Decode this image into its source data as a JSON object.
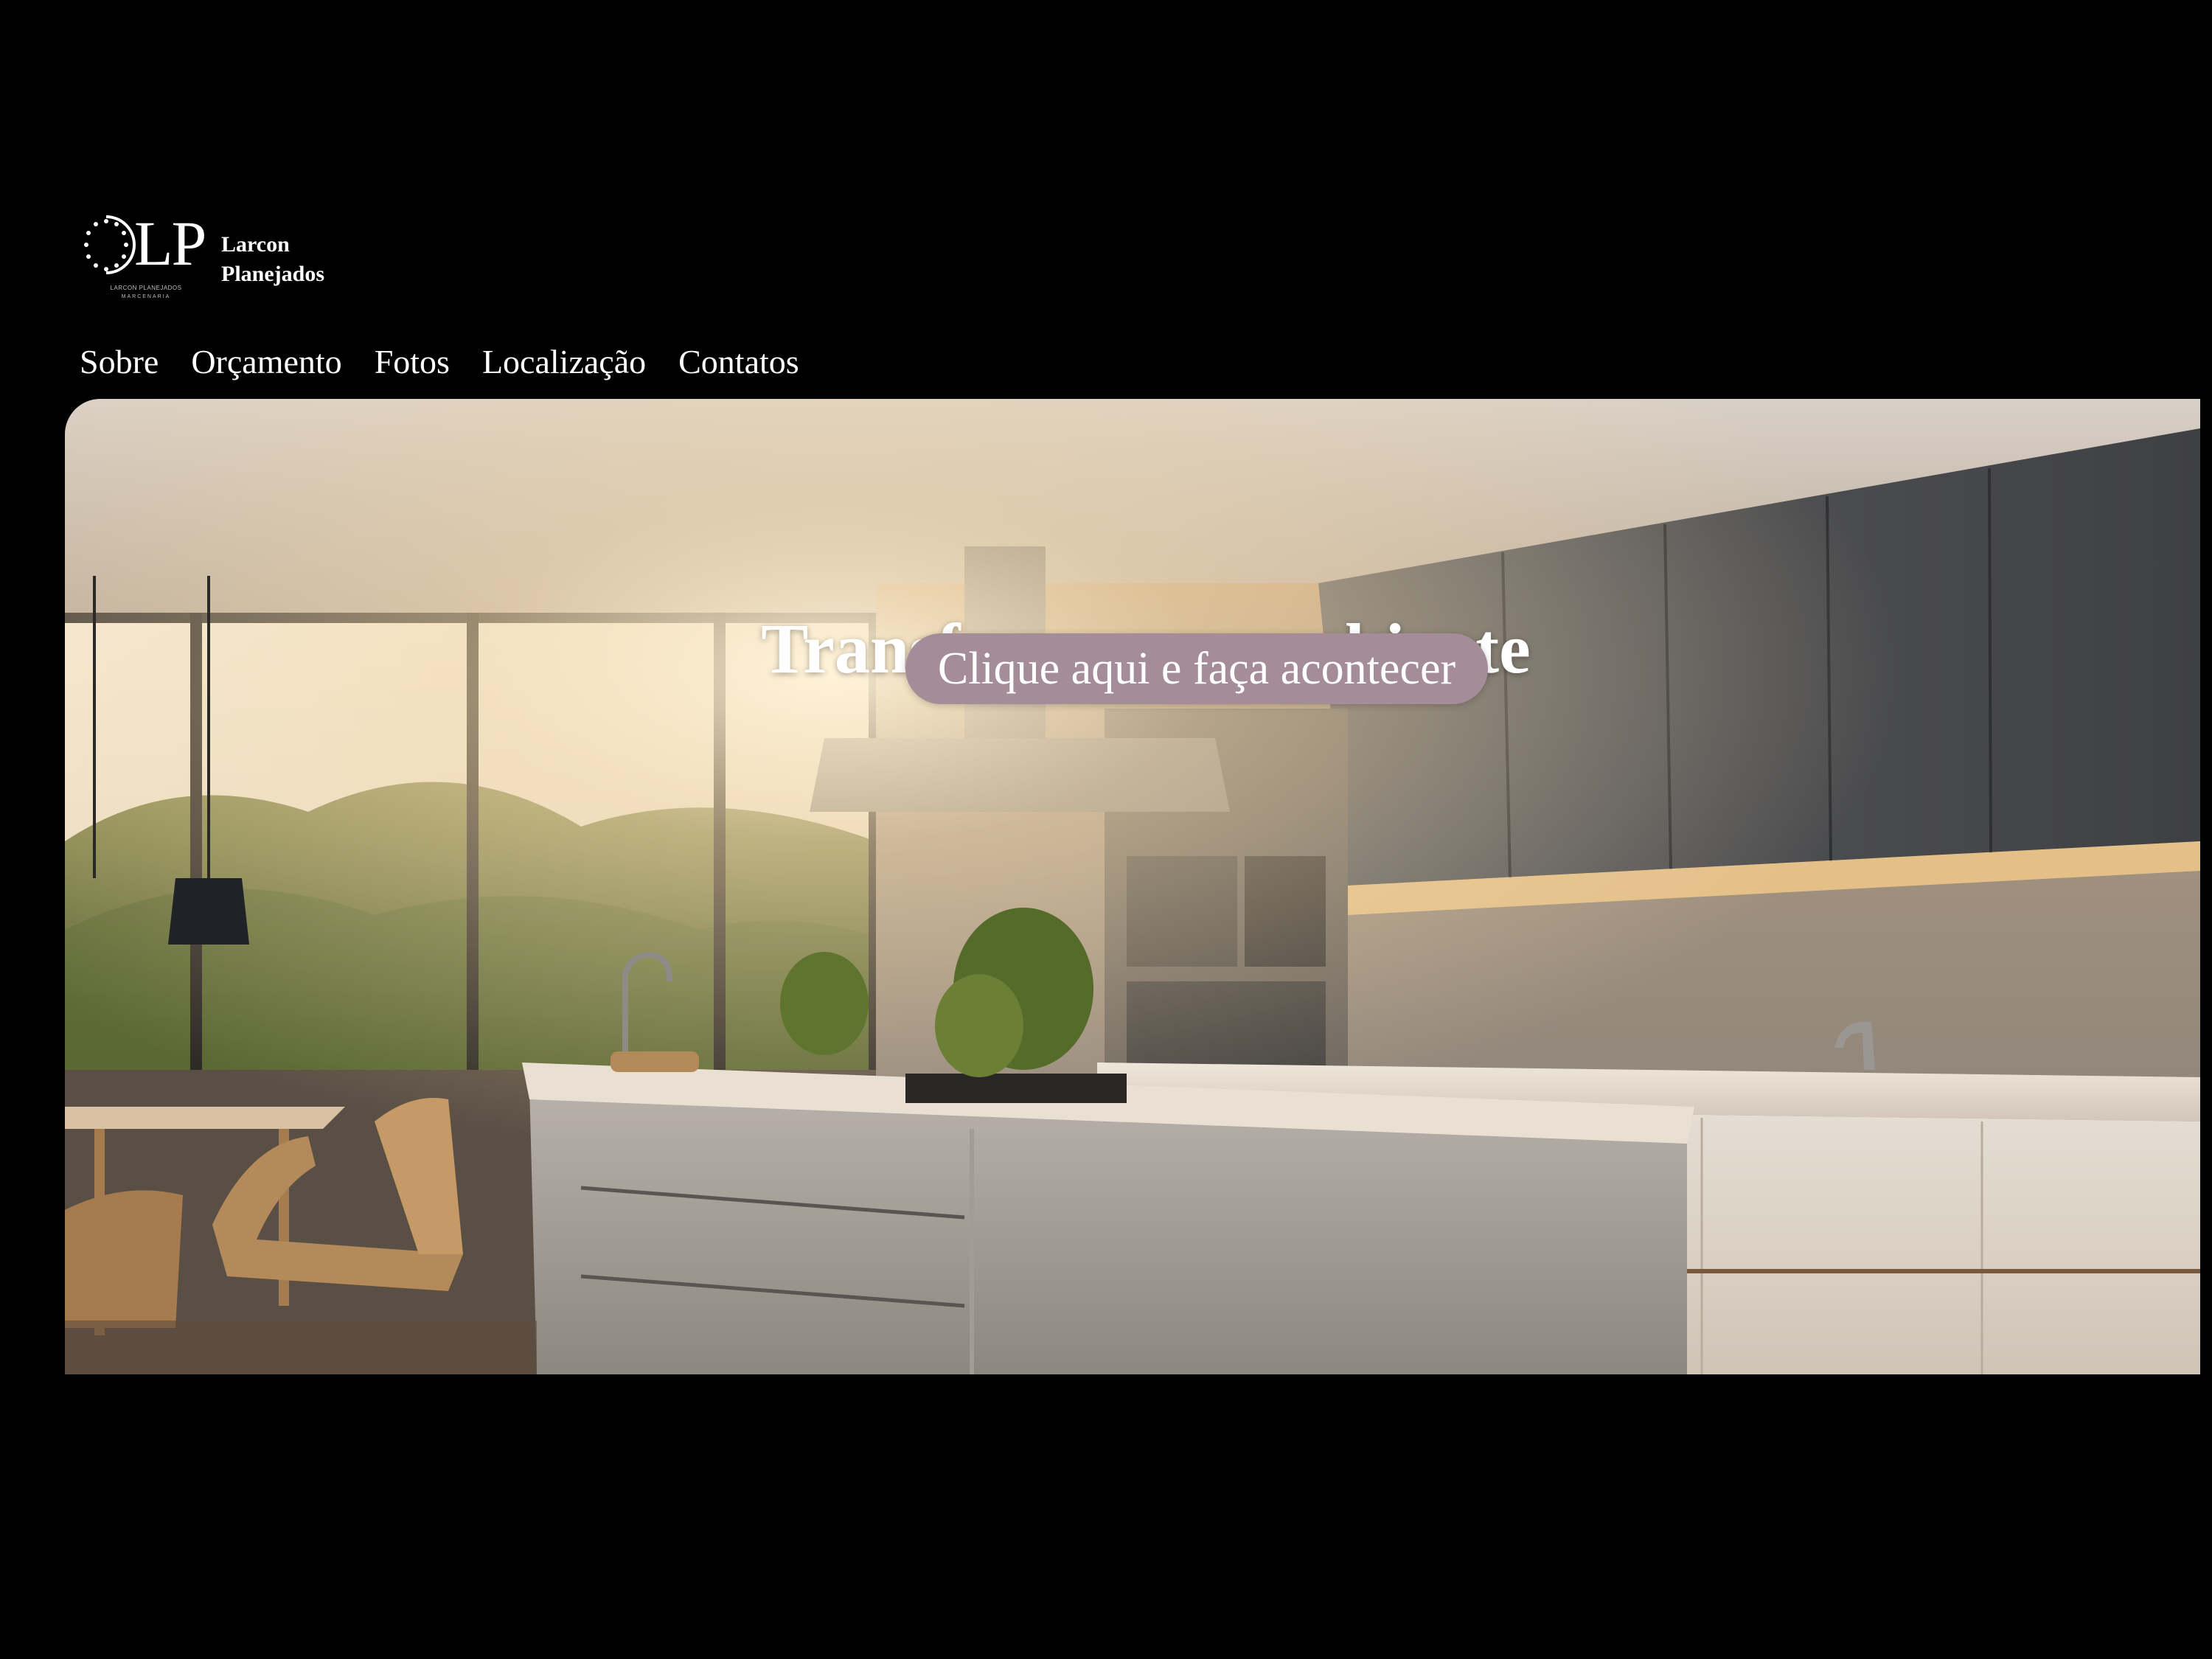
{
  "brand": {
    "logo_text": "LP",
    "logo_sub_line_1": "LARCON PLANEJADOS",
    "logo_sub_line_2": "MARCENARIA",
    "name_line_1": "Larcon",
    "name_line_2": "Planejados"
  },
  "nav": {
    "items": [
      {
        "label": "Sobre"
      },
      {
        "label": "Orçamento"
      },
      {
        "label": "Fotos"
      },
      {
        "label": "Localização"
      },
      {
        "label": "Contatos"
      }
    ]
  },
  "hero": {
    "title": "Transforme seu ambiente",
    "cta_label": "Clique aqui e faça acontecer",
    "image_semantic": "modern-kitchen-photo"
  },
  "colors": {
    "background": "#000000",
    "text": "#ffffff",
    "cta_background": "#a48c99"
  }
}
